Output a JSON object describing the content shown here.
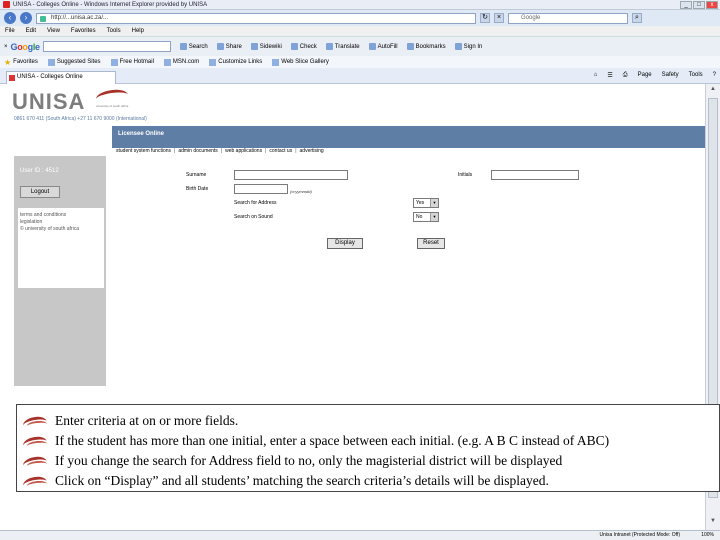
{
  "window": {
    "title": "UNISA - Colleges Online - Windows Internet Explorer provided by UNISA",
    "buttons": [
      "_",
      "□",
      "x"
    ]
  },
  "address_bar": {
    "url": "http://...unisa.ac.za/...",
    "live_search": "Google"
  },
  "menu": [
    "File",
    "Edit",
    "View",
    "Favorites",
    "Tools",
    "Help"
  ],
  "google_toolbar": {
    "logo": "Google",
    "items": [
      "Search",
      "Share",
      "Sidewiki",
      "Check",
      "Translate",
      "AutoFill",
      "Bookmarks",
      "Sign In"
    ]
  },
  "favorites": {
    "label": "Favorites",
    "items": [
      "Suggested Sites",
      "Free Hotmail",
      "MSN.com",
      "Customize Links",
      "Web Slice Gallery"
    ]
  },
  "tab": {
    "label": "UNISA - Colleges Online"
  },
  "command_bar": [
    "Page",
    "Safety",
    "Tools"
  ],
  "site": {
    "logo": "UNISA",
    "logo_sub": "university of south africa",
    "phone": "0861 670 411 (South Africa) +27 11 670 9000 (International)",
    "header_title": "Licensee Online",
    "nav_links": [
      "student system functions",
      "admin documents",
      "web applications",
      "contact us",
      "advertising"
    ],
    "user_id": "User ID : 4512",
    "logout": "Logout",
    "side_links": [
      "terms and conditions",
      "legislation",
      "© university of south africa"
    ]
  },
  "form": {
    "surname_label": "Surname",
    "surname_value": "",
    "initials_label": "Initials",
    "initials_value": "",
    "birth_label": "Birth Date",
    "birth_value": "",
    "birth_hint": "(ccyymmdd)",
    "address_label": "Search for Address",
    "address_value": "Yes",
    "sound_label": "Search on Sound",
    "sound_value": "No",
    "display_button": "Display",
    "reset_button": "Reset"
  },
  "notes": [
    "Enter criteria at on or more fields.",
    "If the student has more than one initial, enter a space between each initial. (e.g. A B C instead of ABC)",
    "If you change the search for Address field to no, only the magisterial district will be displayed",
    "Click on “Display” and all students’ matching the search criteria’s details will be displayed."
  ],
  "status": {
    "zone": "Unisa Intranet (Protected Mode: Off)",
    "zoom": "100%"
  },
  "colors": {
    "brand_red": "#a8322a",
    "header_blue": "#5f7ea6",
    "sidebar_gray": "#c7c7c7"
  }
}
